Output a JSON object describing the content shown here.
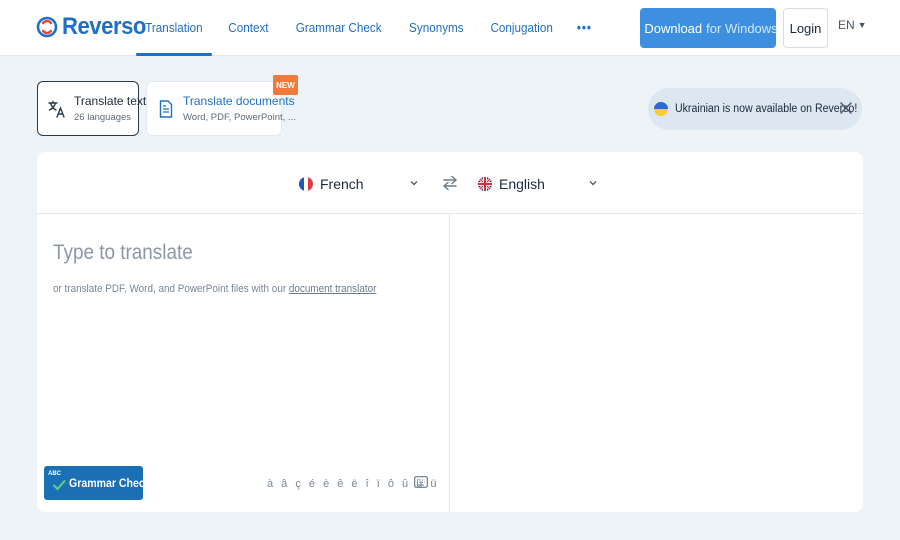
{
  "brand": {
    "name": "Reverso"
  },
  "nav": {
    "items": [
      {
        "label": "Translation",
        "active": true
      },
      {
        "label": "Context"
      },
      {
        "label": "Grammar Check"
      },
      {
        "label": "Synonyms"
      },
      {
        "label": "Conjugation"
      }
    ],
    "more_label": "•••"
  },
  "header": {
    "download_main": "Download",
    "download_rest": "for Windows",
    "login_label": "Login",
    "ui_language": "EN"
  },
  "modes": {
    "text": {
      "title": "Translate text",
      "subtitle": "26 languages"
    },
    "documents": {
      "title": "Translate documents",
      "subtitle": "Word, PDF, PowerPoint, ...",
      "badge": "NEW"
    }
  },
  "notice": {
    "text": "Ukrainian is now available on Reverso!"
  },
  "translator": {
    "source_language": "French",
    "target_language": "English",
    "placeholder": "Type to translate",
    "hint_prefix": "or translate PDF, Word, and PowerPoint files with our",
    "hint_link": "document translator",
    "grammar_badge": "ABC",
    "grammar_button": "Grammar Check",
    "special_chars": "à â ç é è ê ë î ï ô û ù ü"
  },
  "colors": {
    "brand_blue": "#1f6fc6",
    "download_blue": "#3d8fe0",
    "grammar_blue": "#1a6fb5",
    "new_badge": "#f07a3a",
    "background": "#eef3f8"
  }
}
